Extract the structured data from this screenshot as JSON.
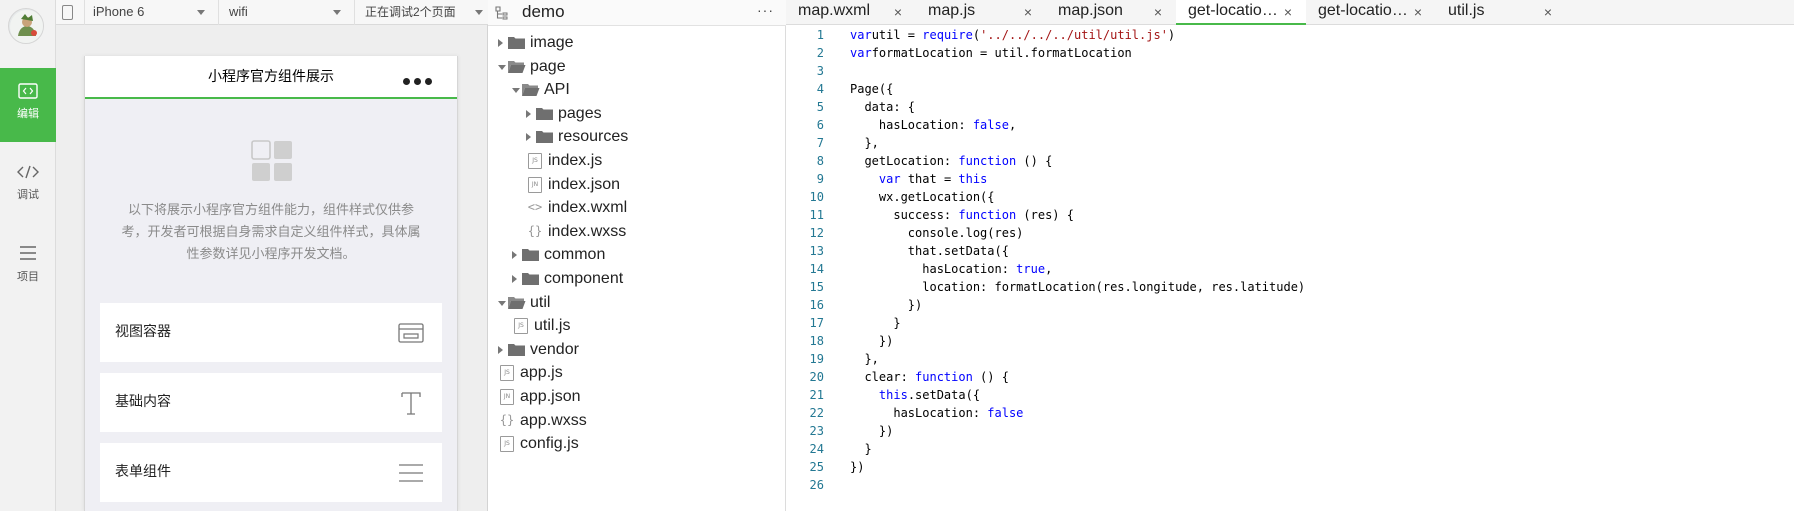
{
  "simulator": {
    "device": "iPhone 6",
    "network": "wifi",
    "debug_pages": "正在调试2个页面",
    "nav_title": "小程序官方组件展示",
    "intro_text": "以下将展示小程序官方组件能力，组件样式仅供参考，开发者可根据自身需求自定义组件样式，具体属性参数详见小程序开发文档。",
    "menu": [
      {
        "label": "视图容器",
        "icon": "view-container-icon"
      },
      {
        "label": "基础内容",
        "icon": "text-t-icon"
      },
      {
        "label": "表单组件",
        "icon": "list-lines-icon"
      }
    ]
  },
  "activity": {
    "items": [
      {
        "label": "编辑",
        "icon": "code-icon",
        "active": true
      },
      {
        "label": "调试",
        "icon": "debug-icon"
      },
      {
        "label": "项目",
        "icon": "menu-icon"
      }
    ]
  },
  "filetree": {
    "project": "demo",
    "more": "···",
    "rows": [
      {
        "name": "image",
        "type": "folder",
        "state": "closed",
        "depth": 0
      },
      {
        "name": "page",
        "type": "folder",
        "state": "open",
        "depth": 0
      },
      {
        "name": "API",
        "type": "folder",
        "state": "open",
        "depth": 1
      },
      {
        "name": "pages",
        "type": "folder",
        "state": "closed",
        "depth": 2
      },
      {
        "name": "resources",
        "type": "folder",
        "state": "closed",
        "depth": 2
      },
      {
        "name": "index.js",
        "type": "file",
        "badge": "JS",
        "depth": 2
      },
      {
        "name": "index.json",
        "type": "file",
        "badge": "JN",
        "depth": 2
      },
      {
        "name": "index.wxml",
        "type": "code",
        "badge": "<>",
        "depth": 2
      },
      {
        "name": "index.wxss",
        "type": "code",
        "badge": "{}",
        "depth": 2
      },
      {
        "name": "common",
        "type": "folder",
        "state": "closed",
        "depth": 1
      },
      {
        "name": "component",
        "type": "folder",
        "state": "closed",
        "depth": 1
      },
      {
        "name": "util",
        "type": "folder",
        "state": "open",
        "depth": 0
      },
      {
        "name": "util.js",
        "type": "file",
        "badge": "JS",
        "depth": 1
      },
      {
        "name": "vendor",
        "type": "folder",
        "state": "closed",
        "depth": 0
      },
      {
        "name": "app.js",
        "type": "file",
        "badge": "JS",
        "depth": 0
      },
      {
        "name": "app.json",
        "type": "file",
        "badge": "JN",
        "depth": 0
      },
      {
        "name": "app.wxss",
        "type": "code",
        "badge": "{}",
        "depth": 0
      },
      {
        "name": "config.js",
        "type": "file",
        "badge": "JS",
        "depth": 0
      }
    ]
  },
  "editor": {
    "tabs": [
      {
        "label": "map.wxml",
        "active": false
      },
      {
        "label": "map.js",
        "active": false
      },
      {
        "label": "map.json",
        "active": false
      },
      {
        "label": "get-location.js",
        "active": true
      },
      {
        "label": "get-location.wxml",
        "active": false
      },
      {
        "label": "util.js",
        "active": false
      }
    ],
    "close_glyph": "×",
    "code_lines": [
      [
        [
          "kw",
          "var"
        ],
        [
          "",
          "util = "
        ],
        [
          "kw",
          "require"
        ],
        [
          "",
          "("
        ],
        [
          "str",
          "'../../../../util/util.js'"
        ],
        [
          "",
          ")"
        ]
      ],
      [
        [
          "kw",
          "var"
        ],
        [
          "",
          "formatLocation = util.formatLocation"
        ]
      ],
      [
        [
          "",
          ""
        ]
      ],
      [
        [
          "",
          "Page({"
        ]
      ],
      [
        [
          "",
          "  data: {"
        ]
      ],
      [
        [
          "",
          "    hasLocation: "
        ],
        [
          "kw",
          "false"
        ],
        [
          "",
          ","
        ]
      ],
      [
        [
          "",
          "  },"
        ]
      ],
      [
        [
          "",
          "  getLocation: "
        ],
        [
          "kw",
          "function"
        ],
        [
          "",
          " () {"
        ]
      ],
      [
        [
          "",
          "    "
        ],
        [
          "kw",
          "var"
        ],
        [
          "",
          "",
          " that = "
        ],
        [
          "kw",
          "this"
        ]
      ],
      [
        [
          "",
          "    wx.getLocation({"
        ]
      ],
      [
        [
          "",
          "      success: "
        ],
        [
          "kw",
          "function"
        ],
        [
          "",
          "",
          " (res) {"
        ]
      ],
      [
        [
          "",
          "        console.log(res)"
        ]
      ],
      [
        [
          "",
          "        that.setData({"
        ]
      ],
      [
        [
          "",
          "          hasLocation: "
        ],
        [
          "kw",
          "true"
        ],
        [
          "",
          ","
        ]
      ],
      [
        [
          "",
          "          location: formatLocation(res.longitude, res.latitude)"
        ]
      ],
      [
        [
          "",
          "        })"
        ]
      ],
      [
        [
          "",
          "      }"
        ]
      ],
      [
        [
          "",
          "    })"
        ]
      ],
      [
        [
          "",
          "  },"
        ]
      ],
      [
        [
          "",
          "  clear: "
        ],
        [
          "kw",
          "function"
        ],
        [
          "",
          "",
          " () {"
        ]
      ],
      [
        [
          "",
          "    "
        ],
        [
          "kw",
          "this"
        ],
        [
          "",
          ".setData({"
        ]
      ],
      [
        [
          "",
          "      hasLocation: "
        ],
        [
          "kw",
          "false"
        ]
      ],
      [
        [
          "",
          "    })"
        ]
      ],
      [
        [
          "",
          "  }"
        ]
      ],
      [
        [
          "",
          "})"
        ]
      ],
      [
        [
          "",
          ""
        ]
      ]
    ]
  }
}
